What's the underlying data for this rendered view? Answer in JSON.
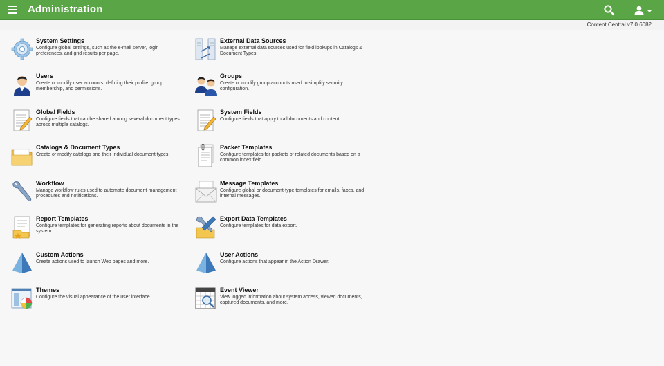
{
  "header": {
    "title": "Administration",
    "menu_icon": "hamburger-menu-icon",
    "search_icon": "search-icon",
    "user_icon": "user-account-icon",
    "accent": "#5aa545"
  },
  "subbar": {
    "version": "Content Central v7.0.6082"
  },
  "items": [
    {
      "name": "System Settings",
      "desc": "Configure global settings, such as the e-mail server, login preferences, and grid results per page.",
      "icon": "gear-icon"
    },
    {
      "name": "External Data Sources",
      "desc": "Manage external data sources used for field lookups in Catalogs & Document Types.",
      "icon": "data-source-icon"
    },
    {
      "name": "Users",
      "desc": "Create or modify user accounts, defining their profile, group membership, and permissions.",
      "icon": "user-icon"
    },
    {
      "name": "Groups",
      "desc": "Create or modify group accounts used to simplify security configuration.",
      "icon": "group-icon"
    },
    {
      "name": "Global Fields",
      "desc": "Configure fields that can be shared among several document types across multiple catalogs.",
      "icon": "form-pencil-icon"
    },
    {
      "name": "System Fields",
      "desc": "Configure fields that apply to all documents and content.",
      "icon": "form-pencil-icon"
    },
    {
      "name": "Catalogs & Document Types",
      "desc": "Create or modify catalogs and their individual document types.",
      "icon": "folder-icon"
    },
    {
      "name": "Packet Templates",
      "desc": "Configure templates for packets of related documents based on a common index field.",
      "icon": "packet-icon"
    },
    {
      "name": "Workflow",
      "desc": "Manage workflow rules used to automate document-management procedures and notifications.",
      "icon": "wrench-icon"
    },
    {
      "name": "Message Templates",
      "desc": "Configure global or document-type templates for emails, faxes, and internal messages.",
      "icon": "envelope-icon"
    },
    {
      "name": "Report Templates",
      "desc": "Configure templates for generating reports about documents in the system.",
      "icon": "report-icon"
    },
    {
      "name": "Export Data Templates",
      "desc": "Configure templates for data export.",
      "icon": "export-tools-icon"
    },
    {
      "name": "Custom Actions",
      "desc": "Create actions used to launch Web pages and more.",
      "icon": "pyramid-icon"
    },
    {
      "name": "User Actions",
      "desc": "Configure actions that appear in the Action Drawer.",
      "icon": "pyramid-icon"
    },
    {
      "name": "Themes",
      "desc": "Configure the visual appearance of the user interface.",
      "icon": "theme-icon"
    },
    {
      "name": "Event Viewer",
      "desc": "View logged information about system access, viewed documents, captured documents, and more.",
      "icon": "event-viewer-icon"
    }
  ]
}
